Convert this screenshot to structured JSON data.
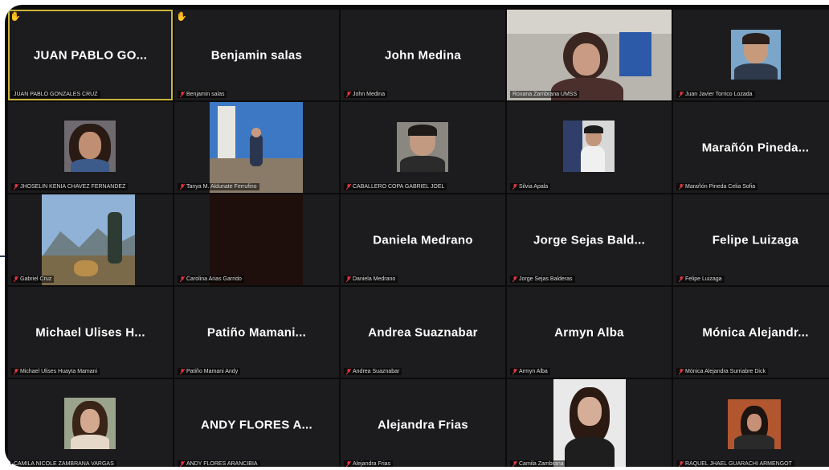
{
  "colors": {
    "background": "#1c1c1e",
    "active_border": "#c9b33a",
    "mute_red": "#e0393e",
    "hand": "#f1c232"
  },
  "tiles": [
    {
      "display": "JUAN PABLO GO...",
      "label": "JUAN PABLO GONZALES CRUZ",
      "hand": "✋"
    },
    {
      "display": "Benjamin salas",
      "label": "Benjamin salas",
      "hand": "✋"
    },
    {
      "display": "John Medina",
      "label": "John Medina"
    },
    {
      "display": "",
      "label": "Roxana Zambrana UMSS"
    },
    {
      "display": "",
      "label": "Juan Javier Torrico Lozada"
    },
    {
      "display": "",
      "label": "JHOSELIN KENIA CHAVEZ FERNANDEZ"
    },
    {
      "display": "",
      "label": "Tanya M. Aldunate Ferrufino"
    },
    {
      "display": "",
      "label": "CABALLERO COPA GABRIEL JOEL"
    },
    {
      "display": "",
      "label": "Silvia Apala"
    },
    {
      "display": "Marañón Pineda...",
      "label": "Marañón Pineda Celia Sofia"
    },
    {
      "display": "",
      "label": "Gabriel Cruz"
    },
    {
      "display": "",
      "label": "Carolina Arias Garrido"
    },
    {
      "display": "Daniela Medrano",
      "label": "Daniela Medrano"
    },
    {
      "display": "Jorge Sejas Bald...",
      "label": "Jorge Sejas Balderas"
    },
    {
      "display": "Felipe Luizaga",
      "label": "Felipe Luizaga"
    },
    {
      "display": "Michael Ulises H...",
      "label": "Michael Ulises Huayta Mamani"
    },
    {
      "display": "Patiño Mamani...",
      "label": "Patiño Mamani Andy"
    },
    {
      "display": "Andrea Suaznabar",
      "label": "Andrea Suaznabar"
    },
    {
      "display": "Armyn Alba",
      "label": "Armyn Alba"
    },
    {
      "display": "Mónica Alejandr...",
      "label": "Mónica Alejandra Surriabre Dick"
    },
    {
      "display": "",
      "label": "CAMILA NICOLE ZAMBRANA VARGAS"
    },
    {
      "display": "ANDY FLORES A...",
      "label": "ANDY FLORES ARANCIBIA"
    },
    {
      "display": "Alejandra Frias",
      "label": "Alejandra Frias"
    },
    {
      "display": "",
      "label": "Camila Zambrana"
    },
    {
      "display": "",
      "label": "RAQUEL JHAEL GUARACHI ARMENGOT"
    }
  ]
}
